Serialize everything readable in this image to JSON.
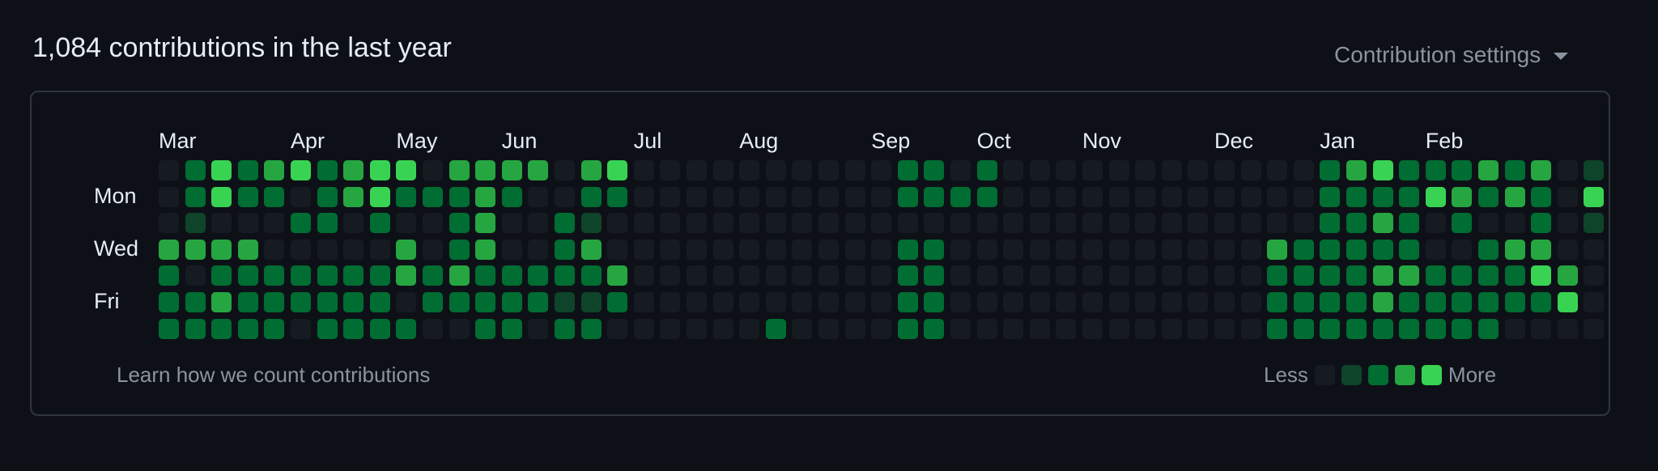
{
  "header": {
    "title": "1,084 contributions in the last year",
    "settings_label": "Contribution settings"
  },
  "calendar": {
    "months": [
      {
        "label": "Mar",
        "week": 0
      },
      {
        "label": "Apr",
        "week": 5
      },
      {
        "label": "May",
        "week": 9
      },
      {
        "label": "Jun",
        "week": 13
      },
      {
        "label": "Jul",
        "week": 18
      },
      {
        "label": "Aug",
        "week": 22
      },
      {
        "label": "Sep",
        "week": 27
      },
      {
        "label": "Oct",
        "week": 31
      },
      {
        "label": "Nov",
        "week": 35
      },
      {
        "label": "Dec",
        "week": 40
      },
      {
        "label": "Jan",
        "week": 44
      },
      {
        "label": "Feb",
        "week": 48
      }
    ],
    "weekdays": [
      "Mon",
      "Wed",
      "Fri"
    ],
    "levels": [
      "0242342344033330340000000000220200000000000023422232301",
      "0242202342223200220000000000222200000000000022224323204",
      "0100022020023002100000000000000000000000000022320200201",
      "3333000003023002300000000000220000000000003222220023300",
      "2022222223232222230000000000220000000000002222332222430",
      "2232222220222221120000000000220000000000002222322222240",
      "2222202222002202200000020000220000000000002222222220000"
    ],
    "palette": [
      "#161b22",
      "#0e4429",
      "#006d32",
      "#26a641",
      "#39d353"
    ]
  },
  "footer": {
    "learn_link": "Learn how we count contributions",
    "less": "Less",
    "more": "More"
  }
}
